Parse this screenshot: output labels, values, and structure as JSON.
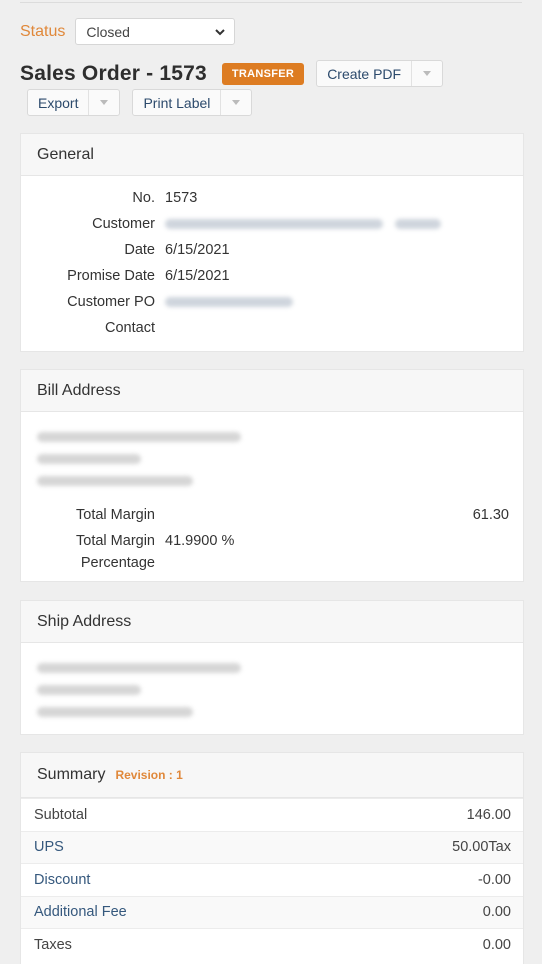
{
  "header": {
    "status_label": "Status",
    "status_value": "Closed",
    "title": "Sales Order - 1573",
    "badge": "TRANSFER",
    "create_pdf": "Create PDF",
    "export": "Export",
    "print_label": "Print Label"
  },
  "general": {
    "title": "General",
    "fields": [
      {
        "label": "No.",
        "value": "1573"
      },
      {
        "label": "Customer",
        "value": "",
        "redacted": true
      },
      {
        "label": "Date",
        "value": "6/15/2021"
      },
      {
        "label": "Promise Date",
        "value": "6/15/2021"
      },
      {
        "label": "Customer PO",
        "value": "",
        "redacted": true
      },
      {
        "label": "Contact",
        "value": ""
      }
    ]
  },
  "bill_address": {
    "title": "Bill Address",
    "lines_redacted": 3,
    "total_margin_label": "Total Margin",
    "total_margin_value": "61.30",
    "total_margin_pct_label_1": "Total Margin",
    "total_margin_pct_label_2": "Percentage",
    "total_margin_pct_value": "41.9900 %"
  },
  "ship_address": {
    "title": "Ship Address",
    "lines_redacted": 3
  },
  "summary": {
    "title": "Summary",
    "revision": "Revision : 1",
    "rows": [
      {
        "label": "Subtotal",
        "value": "146.00",
        "link": false
      },
      {
        "label": "UPS",
        "value": "50.00Tax",
        "link": true
      },
      {
        "label": "Discount",
        "value": "-0.00",
        "link": true
      },
      {
        "label": "Additional Fee",
        "value": "0.00",
        "link": true
      },
      {
        "label": "Taxes",
        "value": "0.00",
        "link": false
      }
    ]
  },
  "colors": {
    "accent_orange": "#dd7c22",
    "link_blue": "#35587d"
  }
}
